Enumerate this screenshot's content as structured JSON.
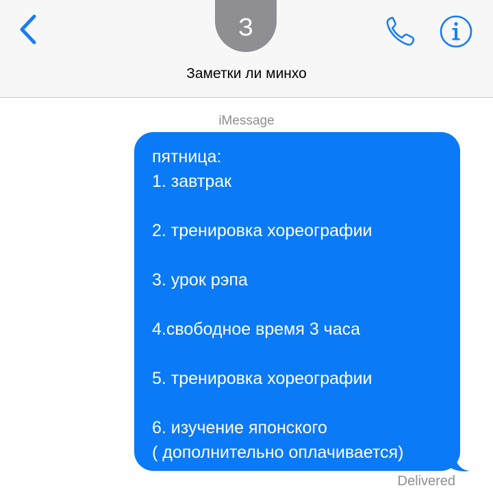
{
  "header": {
    "avatar_initial": "З",
    "contact_name": "Заметки ли минхо",
    "back_icon": "chevron-left-icon",
    "call_icon": "phone-icon",
    "info_icon": "info-icon",
    "accent_color": "#1a7cf5"
  },
  "conversation": {
    "service_label": "iMessage",
    "message": {
      "text": "пятница:\n1. завтрак\n\n2. тренировка хореографии\n\n3. урок рэпа\n\n4.свободное время 3 часа\n\n5. тренировка хореографии\n\n6. изучение японского\n( дополнительно оплачивается)",
      "bubble_color": "#0b7af7"
    },
    "status": "Delivered"
  }
}
